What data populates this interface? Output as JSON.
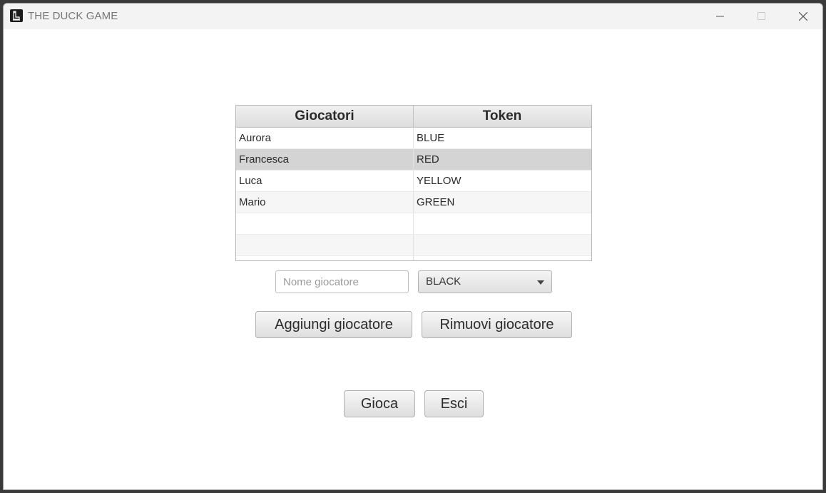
{
  "window": {
    "title": "THE DUCK GAME",
    "controls": [
      "minimize-icon",
      "maximize-icon",
      "close-icon"
    ]
  },
  "players_table": {
    "columns": [
      "Giocatori",
      "Token"
    ],
    "rows": [
      {
        "player": "Aurora",
        "token": "BLUE"
      },
      {
        "player": "Francesca",
        "token": "RED"
      },
      {
        "player": "Luca",
        "token": "YELLOW"
      },
      {
        "player": "Mario",
        "token": "GREEN"
      },
      {
        "player": "",
        "token": ""
      },
      {
        "player": "",
        "token": ""
      },
      {
        "player": "",
        "token": ""
      }
    ],
    "selected_row": 1
  },
  "form": {
    "name_placeholder": "Nome giocatore",
    "name_value": "",
    "token_selected": "BLACK"
  },
  "buttons": {
    "add": "Aggiungi giocatore",
    "remove": "Rimuovi giocatore",
    "play": "Gioca",
    "exit": "Esci"
  }
}
